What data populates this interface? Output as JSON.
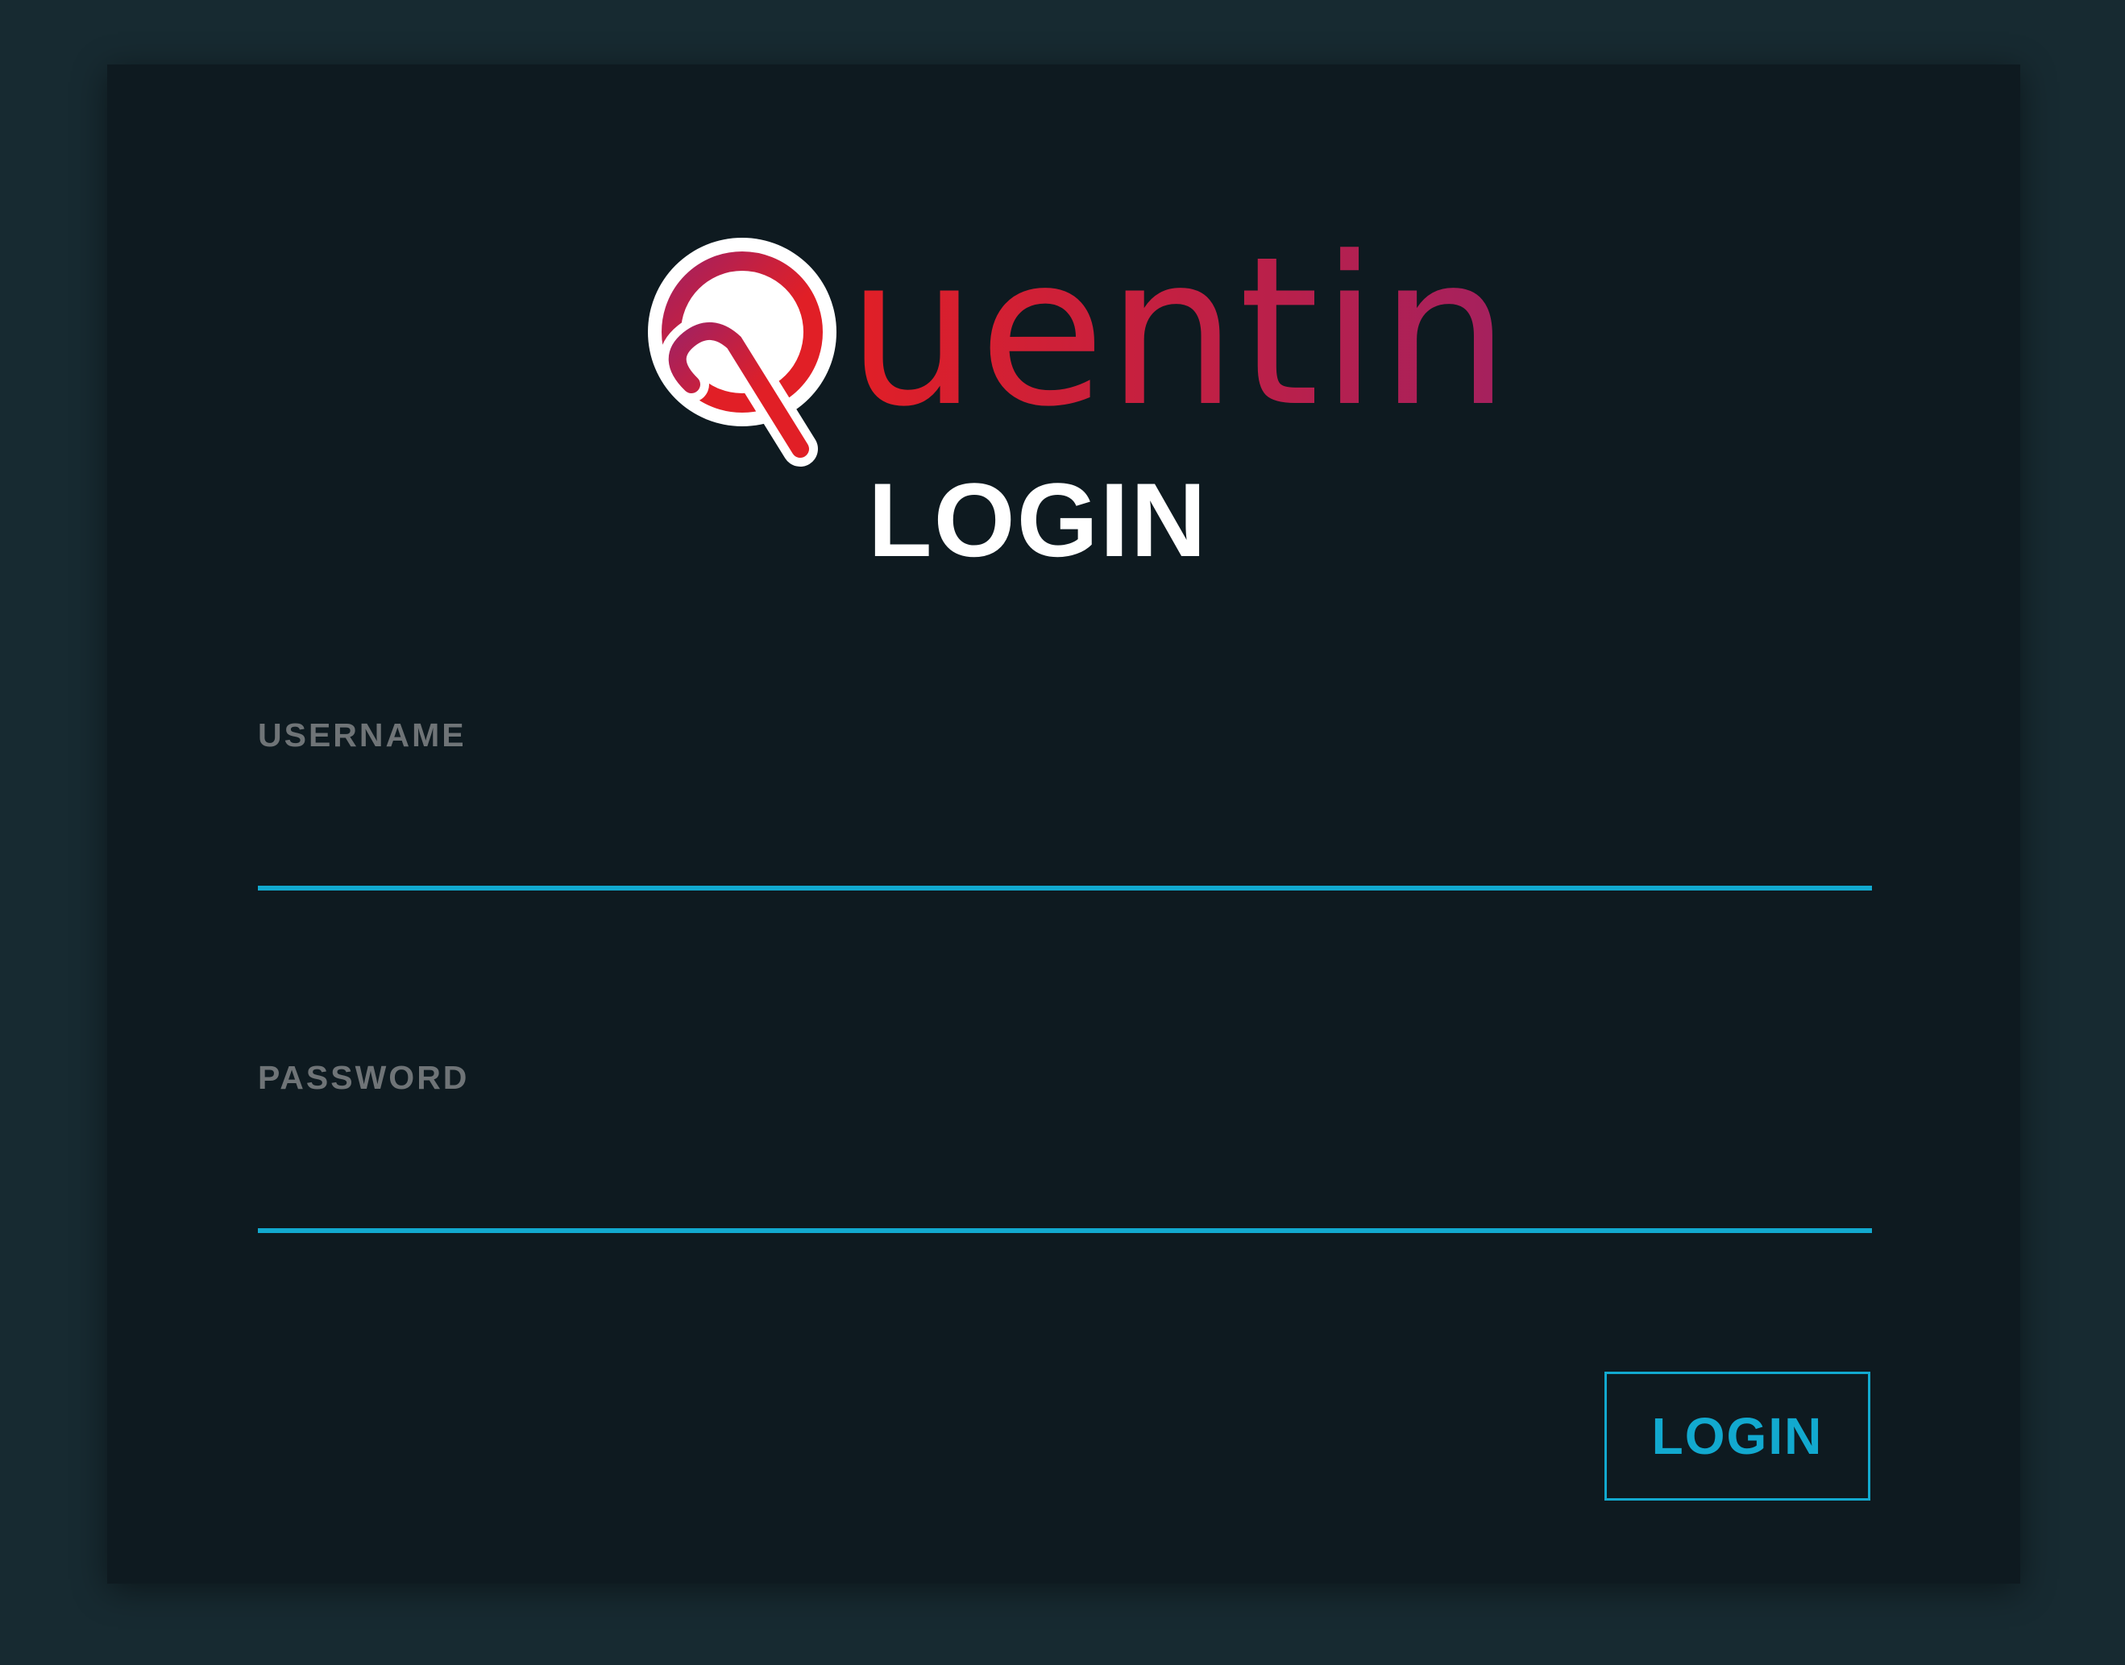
{
  "logo": {
    "text": "uentin",
    "alt": "Quentin"
  },
  "title": "LOGIN",
  "form": {
    "username": {
      "label": "USERNAME",
      "value": "",
      "placeholder": ""
    },
    "password": {
      "label": "PASSWORD",
      "value": "",
      "placeholder": ""
    },
    "submit_label": "LOGIN"
  },
  "colors": {
    "page_background": "#172a31",
    "card_background": "#0e1a20",
    "accent": "#12a9cf",
    "brand_red": "#e11f26",
    "brand_magenta": "#a4215f"
  },
  "icons": {
    "logo_mark": "q-logo-icon"
  }
}
